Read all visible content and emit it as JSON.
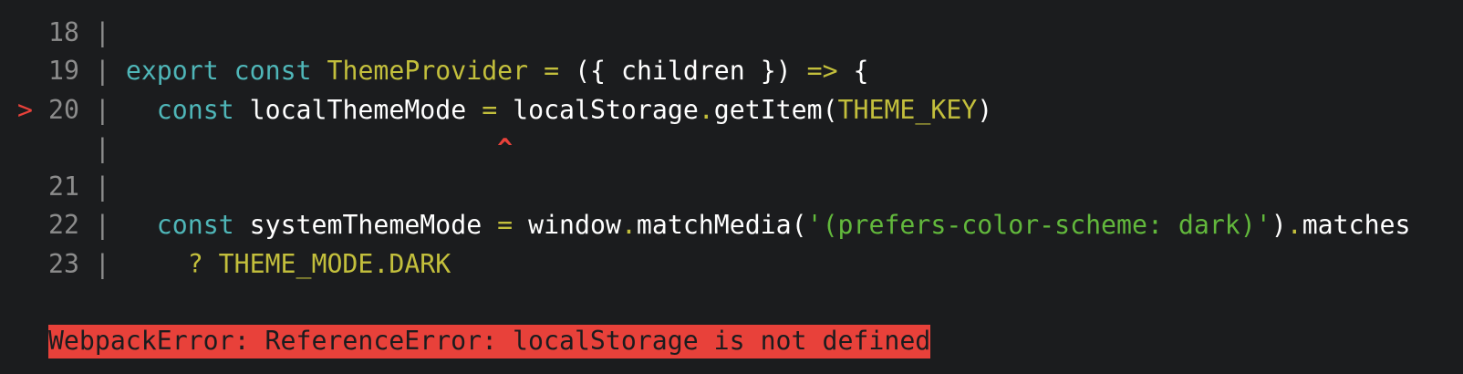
{
  "code_frame": {
    "lines": [
      {
        "marker": " ",
        "number": "18",
        "tokens": []
      },
      {
        "marker": " ",
        "number": "19",
        "tokens": [
          {
            "t": "export",
            "c": "kw"
          },
          {
            "t": " ",
            "c": "pl"
          },
          {
            "t": "const",
            "c": "kw"
          },
          {
            "t": " ",
            "c": "pl"
          },
          {
            "t": "ThemeProvider",
            "c": "yl"
          },
          {
            "t": " ",
            "c": "pl"
          },
          {
            "t": "=",
            "c": "yl"
          },
          {
            "t": " ({ children }) ",
            "c": "pl"
          },
          {
            "t": "=>",
            "c": "yl"
          },
          {
            "t": " {",
            "c": "pl"
          }
        ]
      },
      {
        "marker": ">",
        "number": "20",
        "tokens": [
          {
            "t": "  ",
            "c": "pl"
          },
          {
            "t": "const",
            "c": "kw"
          },
          {
            "t": " localThemeMode ",
            "c": "pl"
          },
          {
            "t": "=",
            "c": "yl"
          },
          {
            "t": " localStorage",
            "c": "pl"
          },
          {
            "t": ".",
            "c": "yl"
          },
          {
            "t": "getItem(",
            "c": "pl"
          },
          {
            "t": "THEME_KEY",
            "c": "yl"
          },
          {
            "t": ")",
            "c": "pl"
          }
        ]
      },
      {
        "marker": " ",
        "number": "  ",
        "tokens": [
          {
            "t": "                        ",
            "c": "pl"
          },
          {
            "t": "^",
            "c": "caret"
          }
        ]
      },
      {
        "marker": " ",
        "number": "21",
        "tokens": []
      },
      {
        "marker": " ",
        "number": "22",
        "tokens": [
          {
            "t": "  ",
            "c": "pl"
          },
          {
            "t": "const",
            "c": "kw"
          },
          {
            "t": " systemThemeMode ",
            "c": "pl"
          },
          {
            "t": "=",
            "c": "yl"
          },
          {
            "t": " window",
            "c": "pl"
          },
          {
            "t": ".",
            "c": "yl"
          },
          {
            "t": "matchMedia(",
            "c": "pl"
          },
          {
            "t": "'(prefers-color-scheme: dark)'",
            "c": "st"
          },
          {
            "t": ")",
            "c": "pl"
          },
          {
            "t": ".",
            "c": "yl"
          },
          {
            "t": "matches",
            "c": "pl"
          }
        ]
      },
      {
        "marker": " ",
        "number": "23",
        "tokens": [
          {
            "t": "    ",
            "c": "pl"
          },
          {
            "t": "? THEME_MODE.DARK",
            "c": "yl"
          }
        ]
      }
    ]
  },
  "error_message": "WebpackError: ReferenceError: localStorage is not defined",
  "colors": {
    "background": "#1b1c1e",
    "error": "#e8413a",
    "keyword": "#4fb6b8",
    "identifier": "#c3bf3c",
    "string": "#62b83c",
    "line_number": "#8c8c8c"
  }
}
